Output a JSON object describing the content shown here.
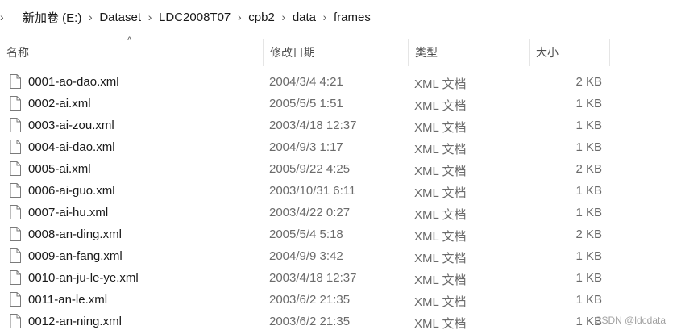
{
  "breadcrumb": [
    "新加卷 (E:)",
    "Dataset",
    "LDC2008T07",
    "cpb2",
    "data",
    "frames"
  ],
  "columns": {
    "name": "名称",
    "date": "修改日期",
    "type": "类型",
    "size": "大小"
  },
  "files": [
    {
      "name": "0001-ao-dao.xml",
      "date": "2004/3/4 4:21",
      "type": "XML 文档",
      "size": "2 KB"
    },
    {
      "name": "0002-ai.xml",
      "date": "2005/5/5 1:51",
      "type": "XML 文档",
      "size": "1 KB"
    },
    {
      "name": "0003-ai-zou.xml",
      "date": "2003/4/18 12:37",
      "type": "XML 文档",
      "size": "1 KB"
    },
    {
      "name": "0004-ai-dao.xml",
      "date": "2004/9/3 1:17",
      "type": "XML 文档",
      "size": "1 KB"
    },
    {
      "name": "0005-ai.xml",
      "date": "2005/9/22 4:25",
      "type": "XML 文档",
      "size": "2 KB"
    },
    {
      "name": "0006-ai-guo.xml",
      "date": "2003/10/31 6:11",
      "type": "XML 文档",
      "size": "1 KB"
    },
    {
      "name": "0007-ai-hu.xml",
      "date": "2003/4/22 0:27",
      "type": "XML 文档",
      "size": "1 KB"
    },
    {
      "name": "0008-an-ding.xml",
      "date": "2005/5/4 5:18",
      "type": "XML 文档",
      "size": "2 KB"
    },
    {
      "name": "0009-an-fang.xml",
      "date": "2004/9/9 3:42",
      "type": "XML 文档",
      "size": "1 KB"
    },
    {
      "name": "0010-an-ju-le-ye.xml",
      "date": "2003/4/18 12:37",
      "type": "XML 文档",
      "size": "1 KB"
    },
    {
      "name": "0011-an-le.xml",
      "date": "2003/6/2 21:35",
      "type": "XML 文档",
      "size": "1 KB"
    },
    {
      "name": "0012-an-ning.xml",
      "date": "2003/6/2 21:35",
      "type": "XML 文档",
      "size": "1 KB"
    }
  ],
  "watermark": "CSDN @ldcdata",
  "icons": {
    "file": "document-icon",
    "separator": "chevron-right-icon",
    "sort": "sort-ascending-icon"
  }
}
